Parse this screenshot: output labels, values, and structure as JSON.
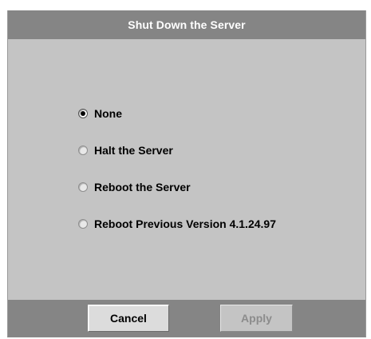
{
  "dialog": {
    "title": "Shut Down the Server"
  },
  "options": [
    {
      "label": "None",
      "selected": true
    },
    {
      "label": "Halt the Server",
      "selected": false
    },
    {
      "label": "Reboot the Server",
      "selected": false
    },
    {
      "label": "Reboot Previous Version 4.1.24.97",
      "selected": false
    }
  ],
  "buttons": {
    "cancel_label": "Cancel",
    "apply_label": "Apply",
    "apply_enabled": false
  },
  "colors": {
    "titlebar": "#858585",
    "panel": "#c4c4c4",
    "disabled_text": "#8c8c8c"
  }
}
